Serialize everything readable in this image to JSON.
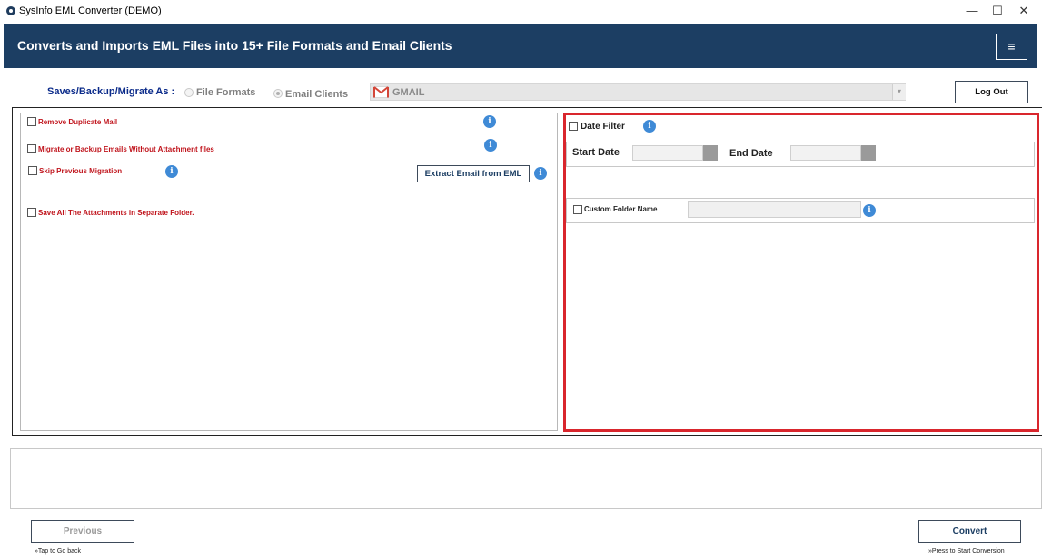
{
  "window": {
    "title": "SysInfo EML Converter (DEMO)",
    "minimize": "—",
    "maximize": "☐",
    "close": "✕"
  },
  "banner": {
    "title": "Converts and Imports EML Files into 15+ File Formats and Email Clients",
    "menu_icon": "≡"
  },
  "saves": {
    "label": "Saves/Backup/Migrate As :",
    "options": [
      {
        "label": "File Formats",
        "selected": false
      },
      {
        "label": "Email Clients",
        "selected": true
      }
    ],
    "selected_client": "GMAIL",
    "dropdown_arrow": "▾"
  },
  "logout_label": "Log Out",
  "options": {
    "remove_duplicate": "Remove Duplicate Mail",
    "without_attachment": "Migrate or Backup Emails Without Attachment files",
    "skip_previous": "Skip Previous Migration",
    "save_attachments": "Save All The Attachments in Separate Folder.",
    "info_glyph": "i"
  },
  "extract_label": "Extract Email from EML",
  "date_filter": {
    "label": "Date Filter",
    "start_label": "Start Date",
    "end_label": "End Date"
  },
  "custom_folder": {
    "label": "Custom Folder Name"
  },
  "footer": {
    "previous_label": "Previous",
    "previous_hint": "»Tap to Go back",
    "convert_label": "Convert",
    "convert_hint": "»Press to Start Conversion"
  },
  "colors": {
    "banner": "#1c3e63",
    "highlight_border": "#d9262d",
    "option_text": "#c0141c",
    "info_icon": "#3f8ad6"
  }
}
